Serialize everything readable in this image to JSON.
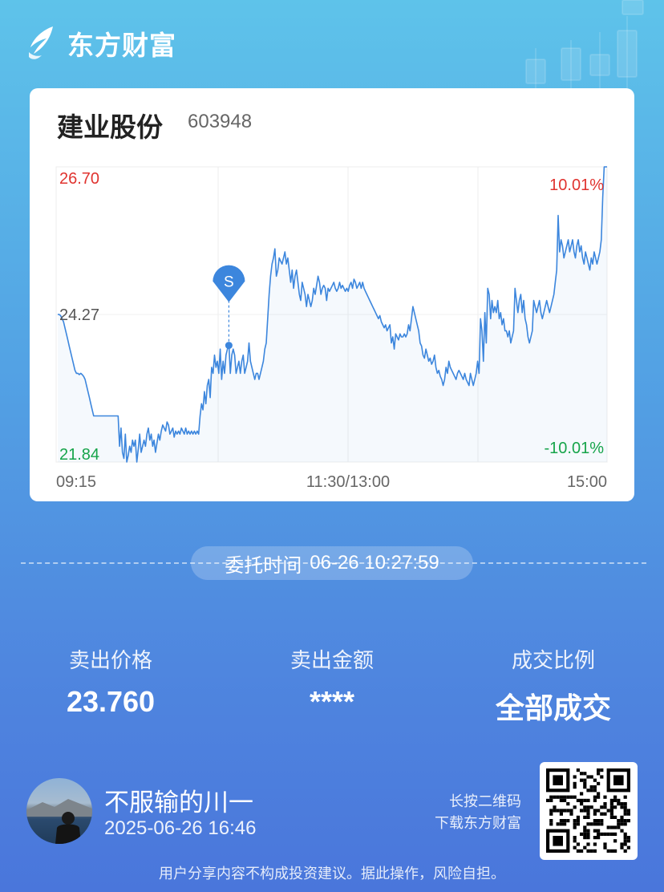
{
  "header": {
    "brand": "东方财富"
  },
  "stock": {
    "name": "建业股份",
    "code": "603948"
  },
  "chart_data": {
    "type": "line",
    "y_labels": {
      "high": "26.70",
      "mid": "24.27",
      "low": "21.84"
    },
    "pct_labels": {
      "high": "10.01%",
      "low": "-10.01%"
    },
    "x_labels": {
      "start": "09:15",
      "mid": "11:30/13:00",
      "end": "15:00"
    },
    "ylim": [
      21.84,
      26.7
    ],
    "prev_close": 24.27,
    "marker": {
      "label": "S",
      "price": 23.76
    },
    "colors": {
      "line": "#3c86dd",
      "up": "#e0332f",
      "down": "#16a44a",
      "neutral": "#555555"
    },
    "series": [
      {
        "values": [
          24.27,
          24.27,
          24.25,
          24.2,
          24.15,
          24.05,
          23.95,
          23.85,
          23.75,
          23.65,
          23.55,
          23.45,
          23.35,
          23.3,
          23.3,
          23.28,
          23.3,
          23.28,
          23.25,
          23.2,
          23.1,
          23.0,
          22.9,
          22.8,
          22.7,
          22.6,
          22.6,
          22.6,
          22.6,
          22.6,
          22.6,
          22.6,
          22.6,
          22.6,
          22.6,
          22.6,
          22.6,
          22.6,
          22.6,
          22.6,
          22.6,
          22.6,
          22.6,
          22.1,
          22.4,
          22.0,
          21.9,
          22.3,
          21.84,
          21.95,
          22.1,
          22.0,
          22.2,
          22.1,
          22.2,
          21.84,
          22.05,
          22.3,
          22.0,
          22.1,
          22.2,
          22.1,
          22.3,
          22.4,
          22.2,
          22.3,
          22.1,
          22.2,
          22.0,
          22.15,
          22.3,
          22.2,
          22.35,
          22.45,
          22.4,
          22.35,
          22.5,
          22.45,
          22.3,
          22.35,
          22.4,
          22.25,
          22.35,
          22.3,
          22.35,
          22.3,
          22.4,
          22.35,
          22.3,
          22.4,
          22.3,
          22.35,
          22.3,
          22.35,
          22.3,
          22.35,
          22.3,
          22.35,
          22.3,
          22.6,
          22.8,
          22.7,
          23.0,
          22.8,
          23.1,
          23.2,
          22.9,
          23.4,
          23.3,
          23.6,
          23.4,
          23.5,
          23.3,
          23.7,
          23.2,
          23.5,
          23.3,
          23.6,
          23.7,
          23.8,
          23.3,
          23.6,
          23.7,
          23.6,
          23.3,
          23.4,
          23.5,
          23.3,
          23.5,
          23.6,
          23.3,
          23.4,
          23.5,
          23.8,
          23.5,
          23.4,
          23.3,
          23.2,
          23.3,
          23.3,
          23.2,
          23.3,
          23.4,
          23.5,
          23.7,
          23.8,
          24.2,
          24.6,
          24.9,
          25.1,
          25.2,
          25.35,
          24.9,
          25.0,
          25.2,
          25.15,
          25.1,
          25.2,
          25.3,
          25.1,
          25.2,
          25.0,
          24.8,
          25.0,
          24.7,
          24.9,
          25.0,
          24.8,
          24.6,
          24.5,
          24.8,
          24.7,
          24.6,
          24.4,
          24.6,
          24.5,
          24.4,
          24.5,
          24.7,
          24.6,
          24.75,
          24.9,
          24.8,
          24.6,
          24.7,
          24.75,
          24.7,
          24.5,
          24.7,
          24.65,
          24.7,
          24.75,
          24.8,
          24.7,
          24.65,
          24.7,
          24.8,
          24.7,
          24.75,
          24.7,
          24.65,
          24.7,
          24.65,
          24.75,
          24.8,
          24.7,
          24.85,
          24.8,
          24.7,
          24.75,
          24.8,
          24.7,
          24.8,
          24.7,
          24.65,
          24.6,
          24.55,
          24.5,
          24.45,
          24.4,
          24.35,
          24.3,
          24.25,
          24.2,
          24.25,
          24.15,
          24.1,
          24.05,
          24.1,
          24.0,
          24.05,
          24.1,
          23.8,
          23.9,
          23.7,
          23.95,
          23.9,
          23.85,
          23.95,
          23.9,
          23.9,
          23.95,
          23.9,
          23.95,
          24.1,
          24.0,
          24.2,
          24.4,
          24.3,
          24.2,
          24.1,
          24.0,
          23.8,
          23.75,
          23.6,
          23.55,
          23.7,
          23.6,
          23.5,
          23.55,
          23.45,
          23.5,
          23.6,
          23.4,
          23.3,
          23.35,
          23.25,
          23.2,
          23.1,
          23.2,
          23.4,
          23.3,
          23.5,
          23.4,
          23.35,
          23.3,
          23.25,
          23.2,
          23.3,
          23.35,
          23.3,
          23.25,
          23.2,
          23.3,
          23.2,
          23.15,
          23.1,
          23.3,
          23.2,
          23.1,
          23.2,
          23.3,
          23.5,
          23.3,
          24.2,
          24.0,
          23.5,
          24.3,
          23.8,
          24.7,
          24.6,
          24.2,
          24.5,
          24.3,
          24.4,
          24.3,
          24.5,
          24.2,
          24.3,
          24.1,
          24.2,
          24.0,
          24.0,
          23.9,
          24.0,
          23.8,
          23.9,
          24.0,
          24.7,
          24.5,
          24.3,
          24.5,
          24.6,
          24.3,
          24.5,
          24.2,
          24.1,
          23.9,
          23.8,
          23.9,
          24.0,
          24.5,
          24.4,
          24.3,
          24.4,
          24.5,
          24.3,
          24.2,
          24.3,
          24.4,
          24.5,
          24.4,
          24.3,
          24.4,
          24.5,
          24.6,
          24.8,
          25.0,
          25.9,
          25.3,
          25.5,
          25.4,
          25.2,
          25.3,
          25.4,
          25.5,
          25.3,
          25.4,
          25.5,
          25.3,
          25.2,
          25.4,
          25.5,
          25.3,
          25.4,
          25.2,
          25.1,
          25.3,
          25.2,
          25.1,
          25.0,
          25.2,
          25.1,
          25.3,
          25.2,
          25.1,
          25.2,
          25.3,
          25.5,
          26.2,
          26.7,
          26.7,
          26.7
        ]
      }
    ]
  },
  "order": {
    "time_label": "委托时间",
    "time_value": "06-26 10:27:59"
  },
  "stats": [
    {
      "label": "卖出价格",
      "value": "23.760"
    },
    {
      "label": "卖出金额",
      "value": "****"
    },
    {
      "label": "成交比例",
      "value": "全部成交"
    }
  ],
  "user": {
    "name": "不服输的川一",
    "time": "2025-06-26 16:46"
  },
  "qr": {
    "hint_line1": "长按二维码",
    "hint_line2": "下载东方财富"
  },
  "footer": {
    "disclaimer": "用户分享内容不构成投资建议。据此操作，风险自担。"
  }
}
